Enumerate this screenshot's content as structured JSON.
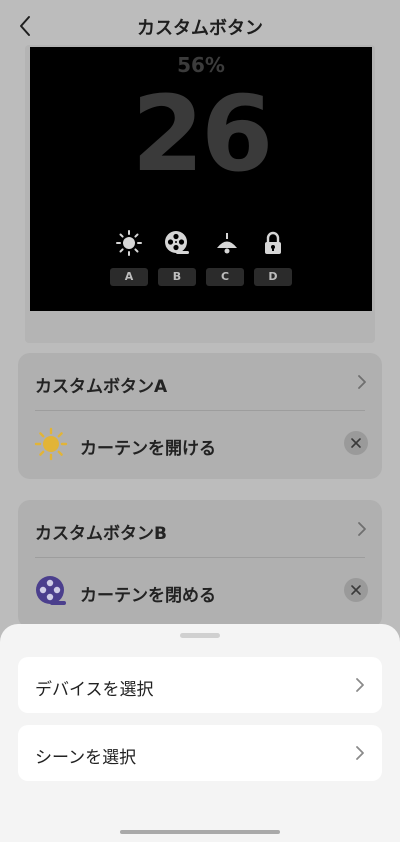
{
  "header": {
    "title": "カスタムボタン"
  },
  "preview": {
    "percent": "56%",
    "number": "26",
    "slots": [
      {
        "label": "A",
        "icon": "sun-icon"
      },
      {
        "label": "B",
        "icon": "film-reel-icon"
      },
      {
        "label": "C",
        "icon": "ceiling-lamp-icon"
      },
      {
        "label": "D",
        "icon": "lock-icon"
      }
    ]
  },
  "cards": [
    {
      "title": "カスタムボタンA",
      "action_label": "カーテンを開ける",
      "action_icon": "sun-icon"
    },
    {
      "title": "カスタムボタンB",
      "action_label": "カーテンを閉める",
      "action_icon": "film-reel-icon"
    }
  ],
  "sheet": {
    "items": [
      {
        "label": "デバイスを選択"
      },
      {
        "label": "シーンを選択"
      }
    ]
  },
  "colors": {
    "sun": "#e2b437",
    "reel": "#4b3f8d",
    "overlay_bg": "#bcbcbc",
    "sheet_bg": "#f4f4f4"
  }
}
